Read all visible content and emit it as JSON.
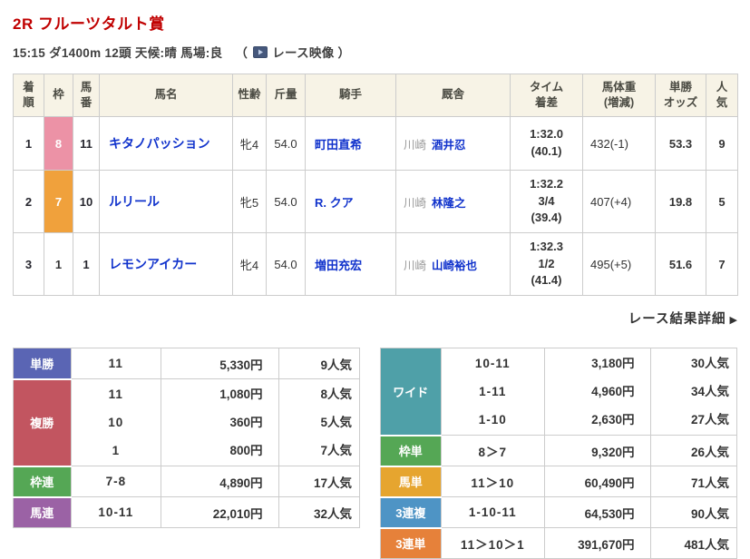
{
  "header": {
    "title": "2R フルーツタルト賞",
    "conditions": "15:15 ダ1400m 12頭  天候:晴 馬場:良",
    "paren_open": "（",
    "video_label": "レース映像",
    "paren_close": "）"
  },
  "results": {
    "headers": [
      "着\n順",
      "枠",
      "馬\n番",
      "馬名",
      "性齢",
      "斤量",
      "騎手",
      "厩舎",
      "タイム\n着差",
      "馬体重\n(増減)",
      "単勝\nオッズ",
      "人\n気"
    ],
    "rows": [
      {
        "rank": "1",
        "waku": "8",
        "waku_bg": "#EC92A6",
        "waku_color": "#FFFFFF",
        "horse_no": "11",
        "horse": "キタノパッション",
        "sex_age": "牝4",
        "weight": "54.0",
        "jockey": "町田直希",
        "stable_loc": "川崎",
        "trainer": "酒井忍",
        "time_text": "1:32.0\n(40.1)",
        "body_weight": "432(-1)",
        "odds": "53.3",
        "pop": "9"
      },
      {
        "rank": "2",
        "waku": "7",
        "waku_bg": "#F0A13C",
        "waku_color": "#FFFFFF",
        "horse_no": "10",
        "horse": "ルリール",
        "sex_age": "牝5",
        "weight": "54.0",
        "jockey": "R. クア",
        "stable_loc": "川崎",
        "trainer": "林隆之",
        "time_text": "1:32.2\n3/4\n(39.4)",
        "body_weight": "407(+4)",
        "odds": "19.8",
        "pop": "5"
      },
      {
        "rank": "3",
        "waku": "1",
        "waku_bg": "#FFFFFF",
        "waku_color": "#333333",
        "horse_no": "1",
        "horse": "レモンアイカー",
        "sex_age": "牝4",
        "weight": "54.0",
        "jockey": "増田充宏",
        "stable_loc": "川崎",
        "trainer": "山崎裕也",
        "time_text": "1:32.3\n1/2\n(41.4)",
        "body_weight": "495(+5)",
        "odds": "51.6",
        "pop": "7"
      }
    ]
  },
  "details_link": {
    "label": "レース結果詳細",
    "arrow": "▶"
  },
  "payouts_left": {
    "tansho": {
      "label": "単勝",
      "bg": "#5A65B4",
      "combo": "11",
      "amount": "5,330円",
      "pop": "9人気"
    },
    "fukusho": {
      "label": "複勝",
      "bg": "#C25560",
      "lines": [
        {
          "combo": "11",
          "amount": "1,080円",
          "pop": "8人気"
        },
        {
          "combo": "10",
          "amount": "360円",
          "pop": "5人気"
        },
        {
          "combo": "1",
          "amount": "800円",
          "pop": "7人気"
        }
      ]
    },
    "wakuren": {
      "label": "枠連",
      "bg": "#55A755",
      "combo": "7-8",
      "amount": "4,890円",
      "pop": "17人気"
    },
    "umaren": {
      "label": "馬連",
      "bg": "#9B62A5",
      "combo": "10-11",
      "amount": "22,010円",
      "pop": "32人気"
    }
  },
  "payouts_right": {
    "wide": {
      "label": "ワイド",
      "bg": "#4FA0A8",
      "lines": [
        {
          "combo": "10-11",
          "amount": "3,180円",
          "pop": "30人気"
        },
        {
          "combo": "1-11",
          "amount": "4,960円",
          "pop": "34人気"
        },
        {
          "combo": "1-10",
          "amount": "2,630円",
          "pop": "27人気"
        }
      ]
    },
    "wakutan": {
      "label": "枠単",
      "bg": "#55A755",
      "combo": "8＞7",
      "amount": "9,320円",
      "pop": "26人気"
    },
    "umatan": {
      "label": "馬単",
      "bg": "#E6A52F",
      "combo": "11＞10",
      "amount": "60,490円",
      "pop": "71人気"
    },
    "sanrenpuku": {
      "label": "3連複",
      "bg": "#4E94C5",
      "combo": "1-10-11",
      "amount": "64,530円",
      "pop": "90人気"
    },
    "sanrentan": {
      "label": "3連単",
      "bg": "#E6813A",
      "combo": "11＞10＞1",
      "amount": "391,670円",
      "pop": "481人気"
    }
  }
}
